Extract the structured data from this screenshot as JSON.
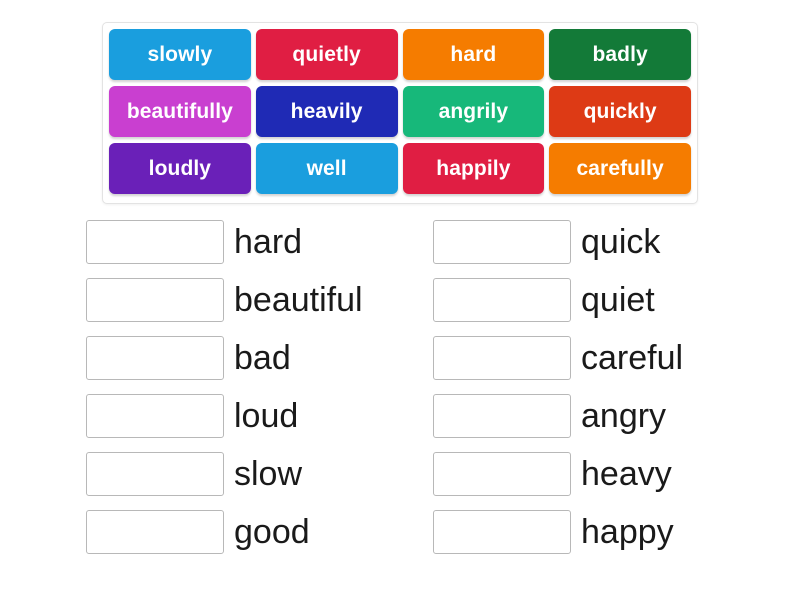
{
  "word_bank": {
    "rows": [
      [
        {
          "label": "slowly",
          "color": "#1a9ede"
        },
        {
          "label": "quietly",
          "color": "#e01e43"
        },
        {
          "label": "hard",
          "color": "#f57c00"
        },
        {
          "label": "badly",
          "color": "#137a38"
        }
      ],
      [
        {
          "label": "beautifully",
          "color": "#c93fd0"
        },
        {
          "label": "heavily",
          "color": "#1f2ab5"
        },
        {
          "label": "angrily",
          "color": "#17b87a"
        },
        {
          "label": "quickly",
          "color": "#dd3a15"
        }
      ],
      [
        {
          "label": "loudly",
          "color": "#6a20b8"
        },
        {
          "label": "well",
          "color": "#1a9ede"
        },
        {
          "label": "happily",
          "color": "#e01e43"
        },
        {
          "label": "carefully",
          "color": "#f57c00"
        }
      ]
    ]
  },
  "answers": {
    "left_column": [
      {
        "label": "hard",
        "value": ""
      },
      {
        "label": "beautiful",
        "value": ""
      },
      {
        "label": "bad",
        "value": ""
      },
      {
        "label": "loud",
        "value": ""
      },
      {
        "label": "slow",
        "value": ""
      },
      {
        "label": "good",
        "value": ""
      }
    ],
    "right_column": [
      {
        "label": "quick",
        "value": ""
      },
      {
        "label": "quiet",
        "value": ""
      },
      {
        "label": "careful",
        "value": ""
      },
      {
        "label": "angry",
        "value": ""
      },
      {
        "label": "heavy",
        "value": ""
      },
      {
        "label": "happy",
        "value": ""
      }
    ]
  }
}
